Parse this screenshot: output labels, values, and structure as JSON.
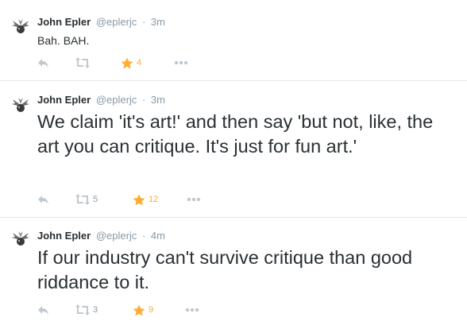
{
  "tweets": [
    {
      "name": "John Epler",
      "handle": "@eplerjc",
      "separator": "·",
      "time": "3m",
      "text": "Bah. BAH.",
      "retweets": "",
      "favorites": "4"
    },
    {
      "name": "John Epler",
      "handle": "@eplerjc",
      "separator": "·",
      "time": "3m",
      "text": "We claim 'it's art!' and then say 'but not, like, the art you can critique. It's just for fun art.'",
      "retweets": "5",
      "favorites": "12"
    },
    {
      "name": "John Epler",
      "handle": "@eplerjc",
      "separator": "·",
      "time": "4m",
      "text": "If our industry can't survive critique than good riddance to it.",
      "retweets": "3",
      "favorites": "9"
    }
  ],
  "colors": {
    "text": "#292f33",
    "muted": "#8899a6",
    "icon": "#c0c9d1",
    "favorite_active": "#ffac33",
    "divider": "#e1e8ed"
  },
  "icons": {
    "avatar": "jester-avatar",
    "reply": "reply-icon",
    "retweet": "retweet-icon",
    "favorite": "star-icon",
    "more": "more-icon"
  }
}
